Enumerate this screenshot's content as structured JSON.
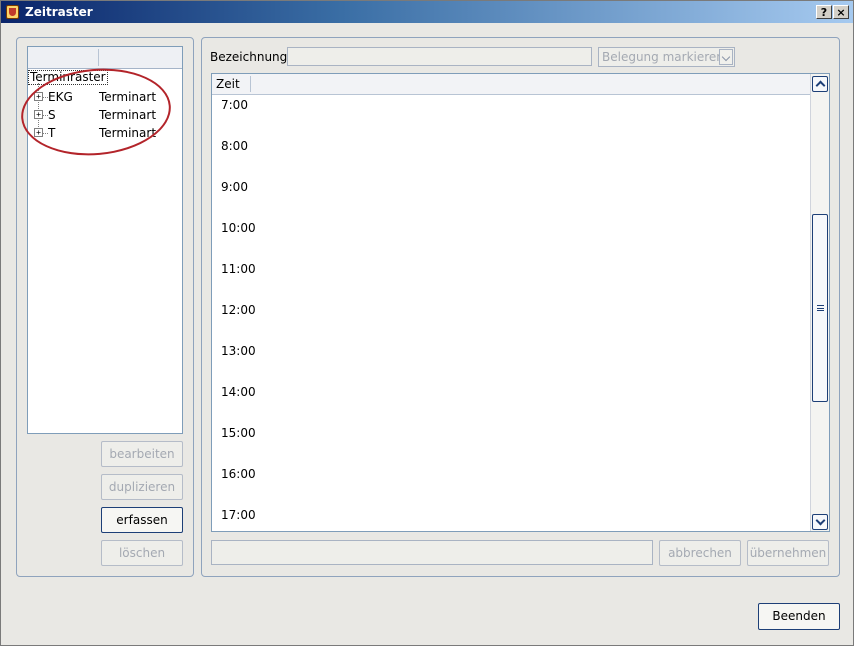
{
  "window": {
    "title": "Zeitraster",
    "help_label": "?",
    "close_label": "×"
  },
  "tree": {
    "root_label": "Terminraster",
    "items": [
      {
        "expander": "+",
        "name": "EKG",
        "type": "Terminart"
      },
      {
        "expander": "+",
        "name": "S",
        "type": "Terminart"
      },
      {
        "expander": "+",
        "name": "T",
        "type": "Terminart"
      }
    ]
  },
  "left_buttons": {
    "edit": "bearbeiten",
    "duplicate": "duplizieren",
    "create": "erfassen",
    "delete": "löschen"
  },
  "right_panel": {
    "name_label": "Bezeichnung",
    "name_value": "",
    "mark_select": "Belegung markieren",
    "time_header": "Zeit",
    "hours": [
      "7:00",
      "8:00",
      "9:00",
      "10:00",
      "11:00",
      "12:00",
      "13:00",
      "14:00",
      "15:00",
      "16:00",
      "17:00"
    ],
    "bottom_field": "",
    "cancel": "abbrechen",
    "apply": "übernehmen"
  },
  "footer": {
    "exit": "Beenden"
  },
  "colors": {
    "title_bar": "#0a246a",
    "annotation": "#b3242a",
    "panel_border": "#8fa3bd"
  }
}
